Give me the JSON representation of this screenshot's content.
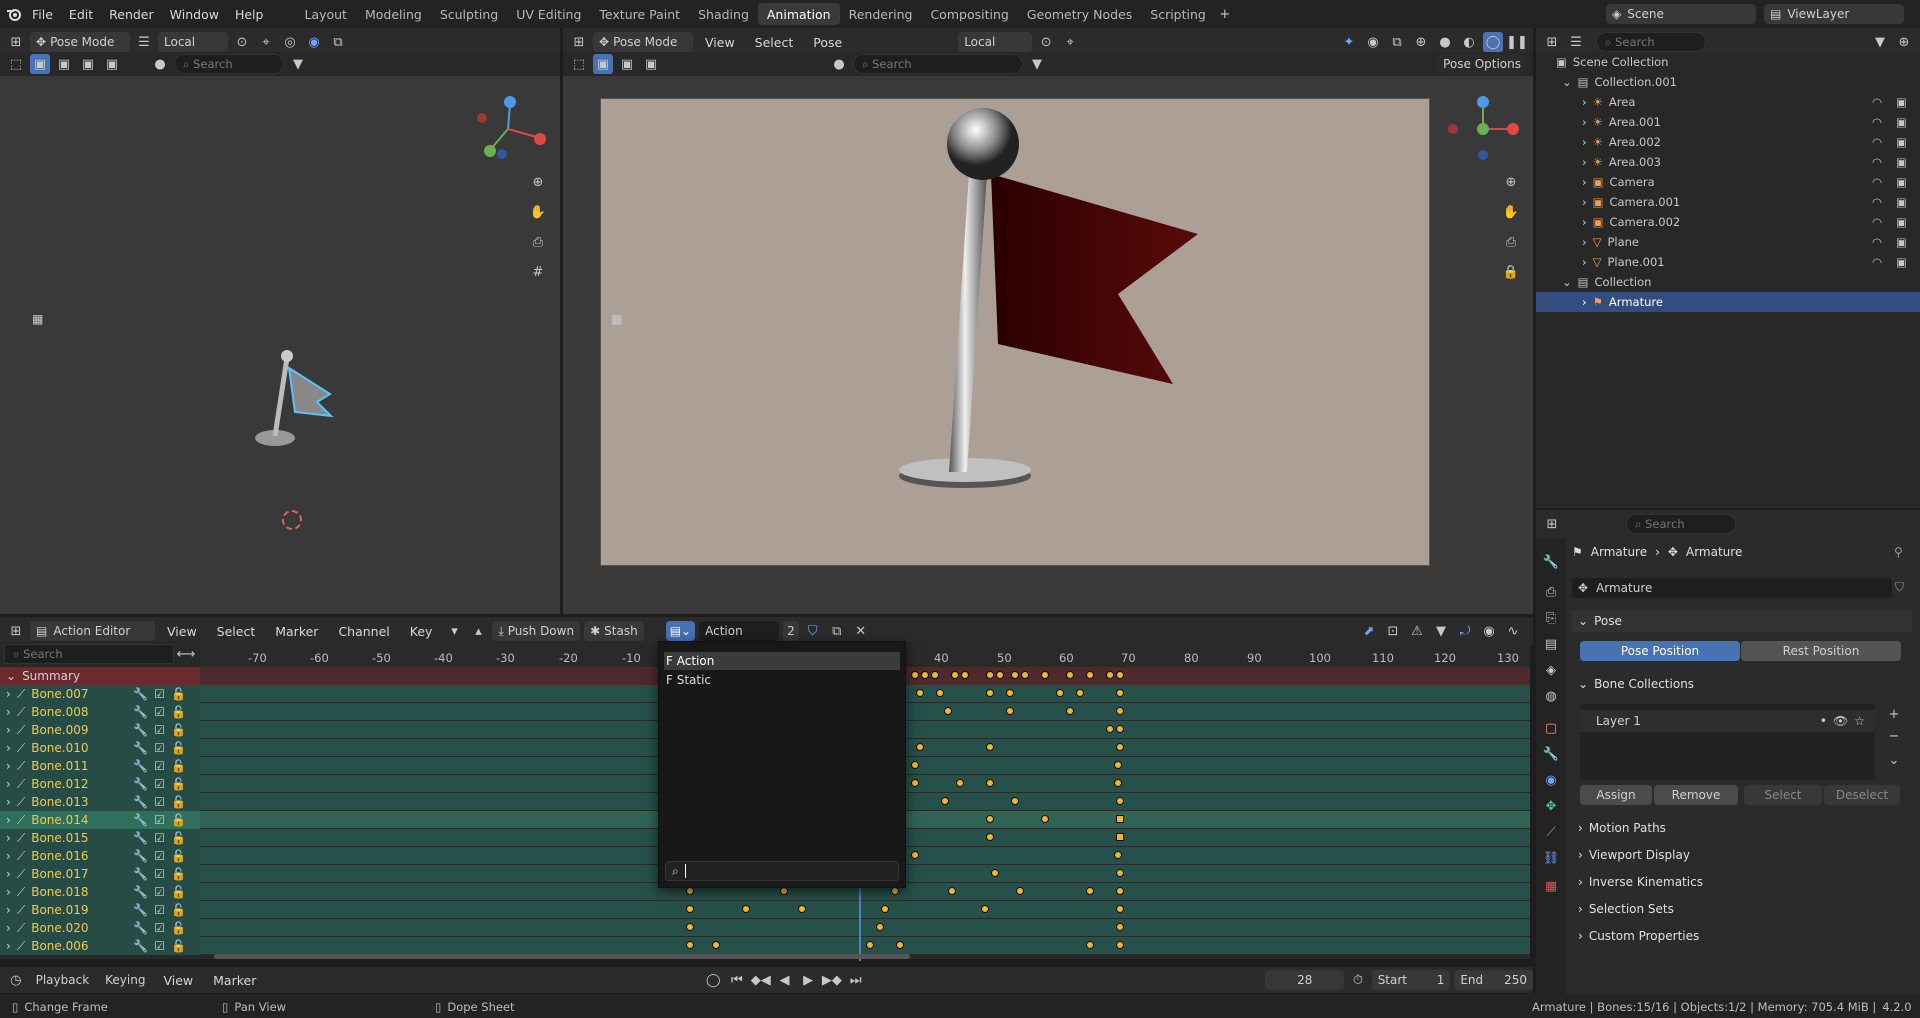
{
  "menu": [
    "File",
    "Edit",
    "Render",
    "Window",
    "Help"
  ],
  "workspaces": [
    "Layout",
    "Modeling",
    "Sculpting",
    "UV Editing",
    "Texture Paint",
    "Shading",
    "Animation",
    "Rendering",
    "Compositing",
    "Geometry Nodes",
    "Scripting"
  ],
  "active_workspace": "Animation",
  "scene": {
    "label": "Scene",
    "view_layer": "ViewLayer"
  },
  "viewport_left": {
    "mode": "Pose Mode",
    "orientation": "Local",
    "search_placeholder": "Search"
  },
  "viewport_right": {
    "mode": "Pose Mode",
    "menus": [
      "View",
      "Select",
      "Pose"
    ],
    "orientation": "Local",
    "search_placeholder": "Search",
    "options": "Pose Options"
  },
  "outliner": {
    "search_placeholder": "Search",
    "root": "Scene Collection",
    "collections": [
      {
        "name": "Collection.001",
        "items": [
          "Area",
          "Area.001",
          "Area.002",
          "Area.003",
          "Camera",
          "Camera.001",
          "Camera.002",
          "Plane",
          "Plane.001"
        ]
      },
      {
        "name": "Collection",
        "items": [
          "Armature"
        ]
      }
    ]
  },
  "properties": {
    "search_placeholder": "Search",
    "breadcrumb": [
      "Armature",
      "Armature"
    ],
    "data_name": "Armature",
    "pose_section": "Pose",
    "pose_position": "Pose Position",
    "rest_position": "Rest Position",
    "bone_collections": "Bone Collections",
    "layer": "Layer 1",
    "assign": "Assign",
    "remove": "Remove",
    "select": "Select",
    "deselect": "Deselect",
    "collapsed_sections": [
      "Motion Paths",
      "Viewport Display",
      "Inverse Kinematics",
      "Selection Sets",
      "Custom Properties"
    ]
  },
  "action_editor": {
    "mode": "Action Editor",
    "menus": [
      "View",
      "Select",
      "Marker",
      "Channel",
      "Key"
    ],
    "push_down": "Push Down",
    "stash": "Stash",
    "action_name": "Action",
    "users": "2",
    "search_placeholder": "Search",
    "summary": "Summary",
    "bones": [
      "Bone.007",
      "Bone.008",
      "Bone.009",
      "Bone.010",
      "Bone.011",
      "Bone.012",
      "Bone.013",
      "Bone.014",
      "Bone.015",
      "Bone.016",
      "Bone.017",
      "Bone.018",
      "Bone.019",
      "Bone.020",
      "Bone.006"
    ],
    "ticks": [
      "-70",
      "-60",
      "-50",
      "-40",
      "-30",
      "-20",
      "-10",
      "40",
      "50",
      "60",
      "70",
      "80",
      "90",
      "100",
      "110",
      "120",
      "130"
    ],
    "dropdown_items": [
      "F Action",
      "F Static"
    ]
  },
  "timeline": {
    "menus": [
      "Playback",
      "Keying",
      "View",
      "Marker"
    ],
    "current_frame": "28",
    "start_label": "Start",
    "start": "1",
    "end_label": "End",
    "end": "250"
  },
  "status": {
    "change_frame": "Change Frame",
    "pan_view": "Pan View",
    "dope_sheet": "Dope Sheet",
    "info": "Armature | Bones:15/16 | Objects:1/2 | Memory: 705.4 MiB |",
    "version": "4.2.0"
  },
  "colors": {
    "accent": "#4772b3",
    "channel_bg": "#2a5a4c",
    "keyframe": "#f2b52b",
    "flag": "#5a0a0a"
  }
}
